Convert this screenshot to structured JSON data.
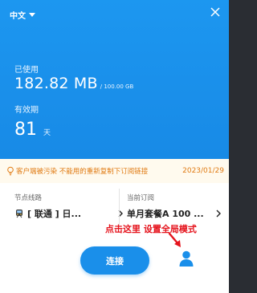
{
  "header": {
    "language": "中文",
    "language_icon": "chevron-down-icon",
    "close_icon": "close-icon"
  },
  "usage": {
    "used_label": "已使用",
    "used_value": "182.82 MB",
    "used_total": "/ 100.00 GB"
  },
  "validity": {
    "label": "有效期",
    "value": "81",
    "unit": "天"
  },
  "notice": {
    "icon": "lightbulb-icon",
    "text": "客户端被污染 不能用的重新复制下订阅链接",
    "date": "2023/01/29"
  },
  "node": {
    "label": "节点线路",
    "icon": "train-icon",
    "name": "[ 联通 ] 日..."
  },
  "subscription": {
    "label": "当前订阅",
    "name": "单月套餐A 100 ..."
  },
  "annotation": {
    "text": "点击这里 设置全局模式"
  },
  "actions": {
    "connect_label": "连接",
    "profile_icon": "user-icon"
  },
  "colors": {
    "accent": "#1a8fea",
    "notice_text": "#e07a12",
    "annotation": "#e5131c"
  }
}
